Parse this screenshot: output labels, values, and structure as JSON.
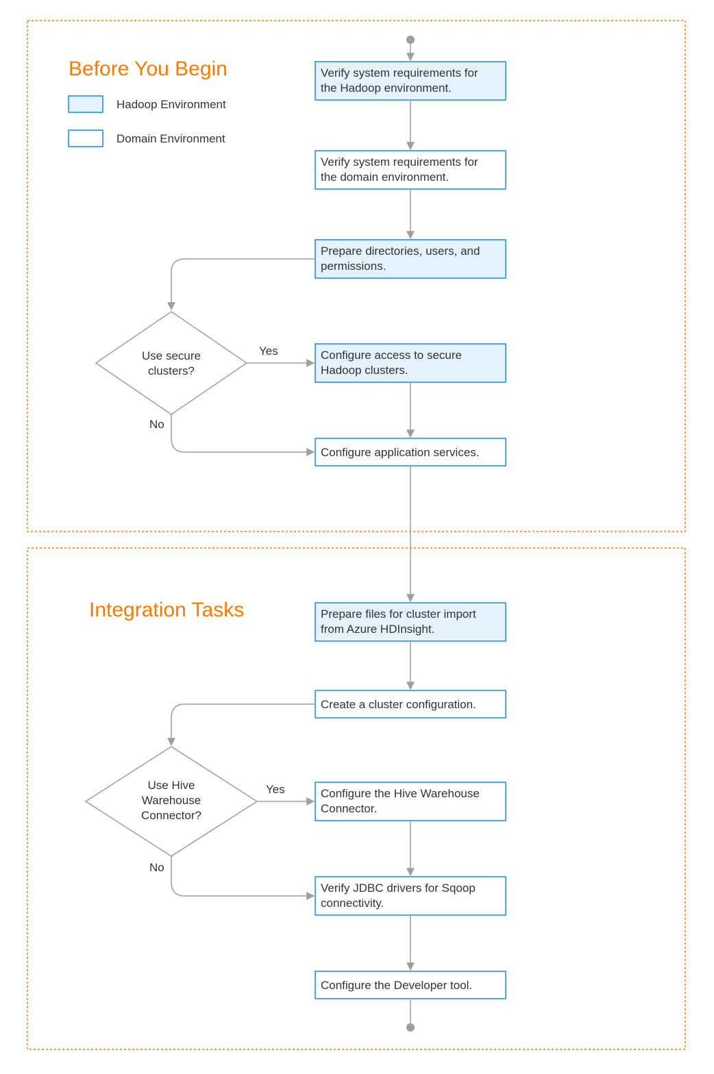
{
  "sections": {
    "before": {
      "title": "Before You Begin"
    },
    "integration": {
      "title": "Integration Tasks"
    }
  },
  "legend": {
    "hadoop": "Hadoop Environment",
    "domain": "Domain Environment"
  },
  "nodes": {
    "b1a": "Verify system requirements for",
    "b1b": "the Hadoop environment.",
    "b2a": "Verify system requirements for",
    "b2b": "the domain environment.",
    "b3a": "Prepare directories, users, and",
    "b3b": "permissions.",
    "d1a": "Use secure",
    "d1b": "clusters?",
    "b4a": "Configure access to secure",
    "b4b": "Hadoop clusters.",
    "b5": "Configure application services.",
    "i1a": "Prepare files for cluster import",
    "i1b": "from Azure HDInsight.",
    "i2": "Create a cluster configuration.",
    "d2a": "Use Hive",
    "d2b": "Warehouse",
    "d2c": "Connector?",
    "i3a": "Configure the Hive Warehouse",
    "i3b": "Connector.",
    "i4a": "Verify JDBC drivers for Sqoop",
    "i4b": "connectivity.",
    "i5": "Configure the Developer tool."
  },
  "edgeLabels": {
    "yes": "Yes",
    "no": "No"
  }
}
